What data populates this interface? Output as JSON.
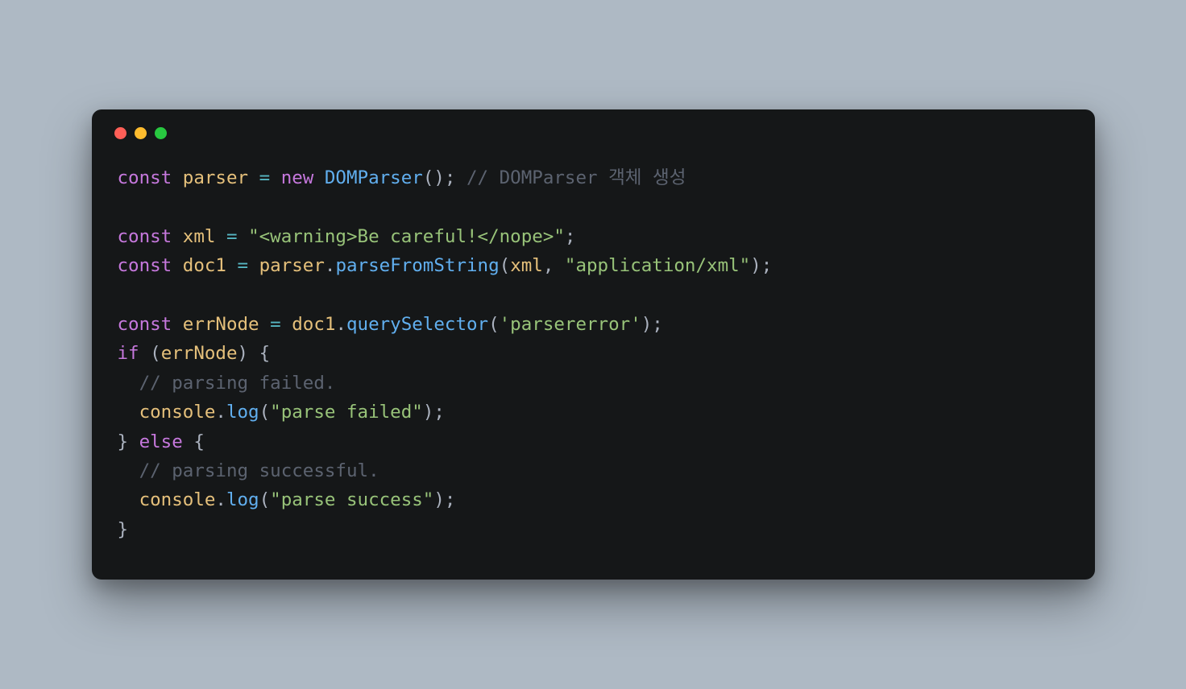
{
  "window": {
    "buttons": [
      "close",
      "minimize",
      "zoom"
    ]
  },
  "code": {
    "kw_const": "const",
    "kw_new": "new",
    "kw_if": "if",
    "kw_else": "else",
    "sp": " ",
    "eq": "=",
    "semi": ";",
    "op_paren": "(",
    "cl_paren": ")",
    "op_brace": "{",
    "cl_brace": "}",
    "comma": ",",
    "dot": ".",
    "var_parser": "parser",
    "cls_DOMParser": "DOMParser",
    "cmt_line1": "// DOMParser 객체 생성",
    "var_xml": "xml",
    "str_xml": "\"<warning>Be careful!</nope>\"",
    "var_doc1": "doc1",
    "fn_parseFromString": "parseFromString",
    "str_appxml": "\"application/xml\"",
    "var_errNode": "errNode",
    "fn_querySelector": "querySelector",
    "str_parsererror": "'parsererror'",
    "cmt_failed": "// parsing failed.",
    "var_console": "console",
    "fn_log": "log",
    "str_failed": "\"parse failed\"",
    "cmt_success": "// parsing successful.",
    "str_success": "\"parse success\"",
    "indent": "  "
  }
}
